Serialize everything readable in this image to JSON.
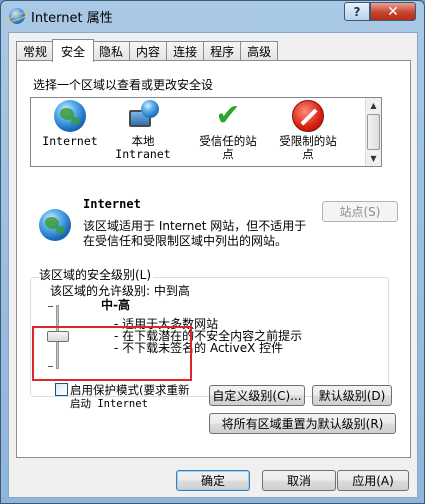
{
  "window": {
    "title": "Internet 属性",
    "help_label": "?",
    "close_label": "✕"
  },
  "tabs": [
    {
      "label": "常规"
    },
    {
      "label": "安全",
      "active": true
    },
    {
      "label": "隐私"
    },
    {
      "label": "内容"
    },
    {
      "label": "连接"
    },
    {
      "label": "程序"
    },
    {
      "label": "高级"
    }
  ],
  "security": {
    "zone_prompt": "选择一个区域以查看或更改安全设",
    "zones": [
      {
        "label_line1": "Internet",
        "label_line2": "",
        "icon": "internet-globe-icon"
      },
      {
        "label_line1": "本地",
        "label_line2": "Intranet",
        "icon": "local-intranet-icon"
      },
      {
        "label_line1": "受信任的站",
        "label_line2": "点",
        "icon": "trusted-sites-check-icon"
      },
      {
        "label_line1": "受限制的站",
        "label_line2": "点",
        "icon": "restricted-sites-no-entry-icon"
      }
    ],
    "selected_zone": {
      "name": "Internet",
      "desc_line1": "该区域适用于 Internet 网站，但不适用于",
      "desc_line2": "在受信任和受限制区域中列出的网站。"
    },
    "sites_button": "站点(S)",
    "level_group_label": "该区域的安全级别(L)",
    "allowed_levels": "该区域的允许级别: 中到高",
    "level_name": "中-高",
    "level_bullets": [
      "- 适用于大多数网站",
      "- 在下载潜在的不安全内容之前提示",
      "- 不下载未签名的 ActiveX 控件"
    ],
    "protected_mode_line1": "启用保护模式(要求重新",
    "protected_mode_line2": "启动 Internet",
    "protected_mode_checked": false,
    "custom_level_button": "自定义级别(C)...",
    "default_level_button": "默认级别(D)",
    "reset_all_button": "将所有区域重置为默认级别(R)"
  },
  "footer": {
    "ok": "确定",
    "cancel": "取消",
    "apply": "应用(A)"
  },
  "colors": {
    "highlight_box": "#e0242c",
    "window_frame": "#8fb5da"
  }
}
